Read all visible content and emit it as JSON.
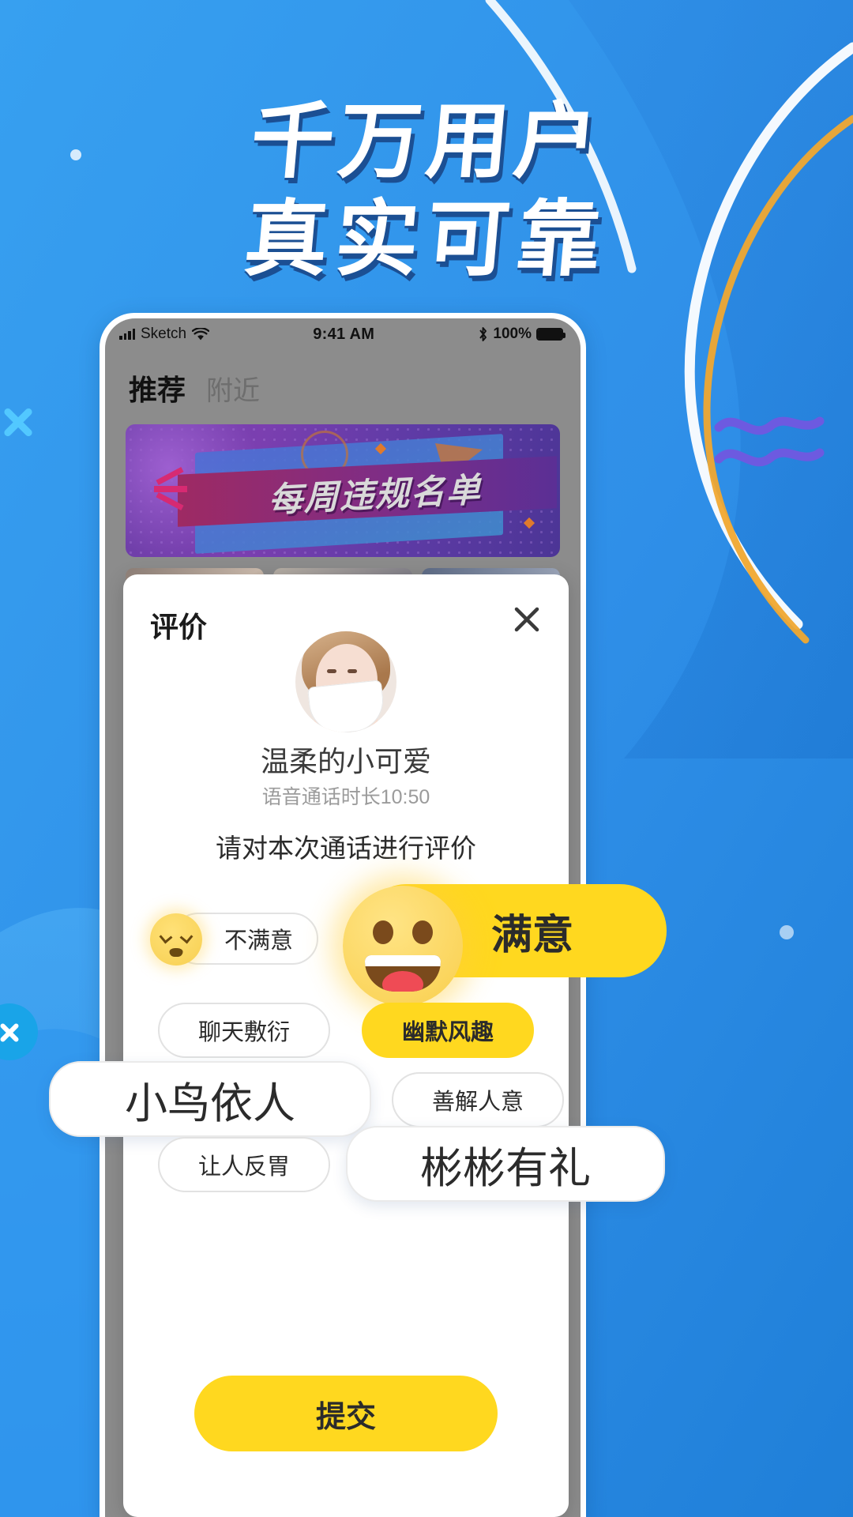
{
  "headline": {
    "line1": "千万用户",
    "line2": "真实可靠"
  },
  "colors": {
    "background_blue": "#3091eb",
    "headline_white": "#ffffff",
    "headline_shadow": "#1b4f93",
    "accent_yellow": "#ffd81f",
    "banner_purple": "#6d3fa8",
    "wave_purple": "#6d5ae0",
    "wave_yellow": "#f0a830",
    "deco_cyan": "#52c8ff"
  },
  "phone": {
    "status_bar": {
      "carrier": "Sketch",
      "signal_icon": "signal-bars-icon",
      "wifi_icon": "wifi-icon",
      "time": "9:41 AM",
      "bluetooth_icon": "bluetooth-icon",
      "battery_percent": "100%",
      "battery_icon": "battery-full-icon"
    },
    "tabs": [
      {
        "label": "推荐",
        "active": true
      },
      {
        "label": "附近",
        "active": false
      }
    ],
    "banner": {
      "title": "每周违规名单"
    },
    "photo_cells": [
      "photo-1",
      "photo-2",
      "photo-3"
    ]
  },
  "modal": {
    "title": "评价",
    "close_icon": "close-icon",
    "avatar": "user-avatar",
    "nickname": "温柔的小可爱",
    "duration": "语音通话时长10:50",
    "prompt": "请对本次通话进行评价",
    "satisfaction": {
      "dissatisfied": {
        "label": "不满意",
        "emoji": "sad-face-emoji",
        "selected": false
      },
      "satisfied": {
        "label": "满意",
        "emoji": "happy-face-emoji",
        "selected": true
      }
    },
    "tags": [
      {
        "label": "聊天敷衍",
        "selected": false,
        "emphasis": "small"
      },
      {
        "label": "幽默风趣",
        "selected": true,
        "emphasis": "small"
      },
      {
        "label": "小鸟依人",
        "selected": false,
        "emphasis": "large"
      },
      {
        "label": "善解人意",
        "selected": false,
        "emphasis": "small"
      },
      {
        "label": "让人反胃",
        "selected": false,
        "emphasis": "small"
      },
      {
        "label": "彬彬有礼",
        "selected": false,
        "emphasis": "large"
      }
    ],
    "submit_label": "提交"
  }
}
